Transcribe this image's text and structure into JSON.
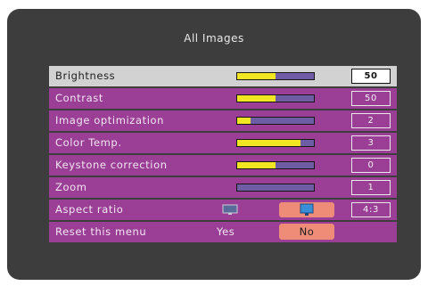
{
  "menu": {
    "title": "All Images",
    "items": [
      {
        "label": "Brightness",
        "level": 0.5,
        "value": "50"
      },
      {
        "label": "Contrast",
        "level": 0.5,
        "value": "50"
      },
      {
        "label": "Image optimization",
        "level": 0.18,
        "value": "2"
      },
      {
        "label": "Color Temp.",
        "level": 0.82,
        "value": "3"
      },
      {
        "label": "Keystone correction",
        "level": 0.5,
        "value": "0"
      },
      {
        "label": "Zoom",
        "level": 0,
        "value": "1"
      }
    ],
    "aspect": {
      "label": "Aspect ratio",
      "value": "4:3",
      "options": [
        "monitor-4-3-icon",
        "monitor-16-9-icon"
      ]
    },
    "reset": {
      "label": "Reset this menu",
      "yes": "Yes",
      "no": "No"
    }
  },
  "colors": {
    "row_bg": "#9b3f96",
    "selected_bg": "#d2d2d2",
    "bar_fill": "#f1e622",
    "bar_track": "#6e5ca4",
    "highlight": "#ee8c78",
    "panel": "#3d3d3d"
  }
}
